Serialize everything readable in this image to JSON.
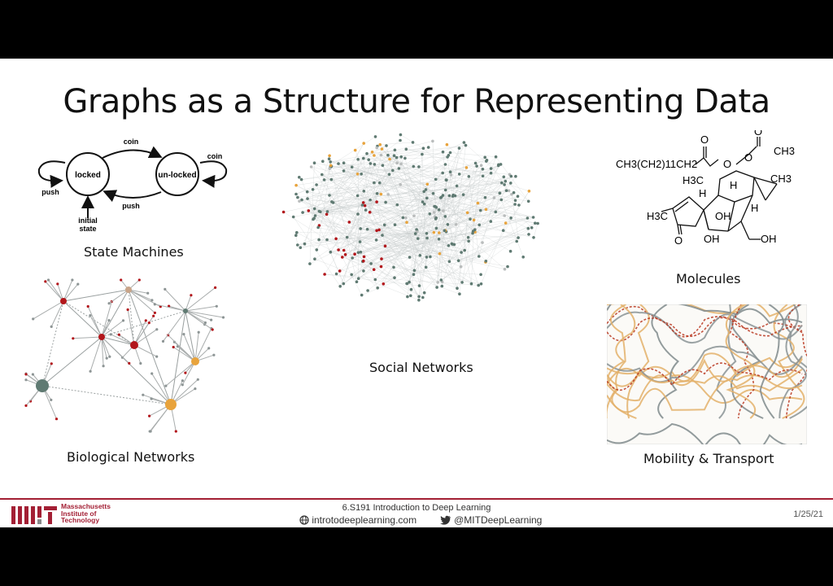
{
  "title": "Graphs as a Structure for Representing Data",
  "state_machine": {
    "caption": "State Machines",
    "node_locked": "locked",
    "node_unlocked": "un-locked",
    "edge_top": "coin",
    "edge_bottom": "push",
    "self_left": "push",
    "self_right": "coin",
    "initial_line1": "initial",
    "initial_line2": "state"
  },
  "social": {
    "caption": "Social Networks"
  },
  "molecule": {
    "caption": "Molecules",
    "chain": "CH3(CH2)11CH2",
    "ch3_top": "CH3",
    "ch3_right": "CH3",
    "ch3_left": "H3C",
    "ch3_far_left": "H3C",
    "h1": "H",
    "h2": "H",
    "h3": "H",
    "oh1": "OH",
    "oh2": "OH",
    "oh3": "OH",
    "o_ketone": "O",
    "o1": "O",
    "o2": "O",
    "o3": "O",
    "o4": "O"
  },
  "bio": {
    "caption": "Biological Networks"
  },
  "mobility": {
    "caption": "Mobility & Transport"
  },
  "footer": {
    "institute_line1": "Massachusetts",
    "institute_line2": "Institute of",
    "institute_line3": "Technology",
    "course": "6.S191 Introduction to Deep Learning",
    "website": "introtodeeplearning.com",
    "twitter": "@MITDeepLearning",
    "date": "1/25/21"
  },
  "colors": {
    "mit_red": "#a31f34",
    "node_gray": "#5f7a72",
    "node_red": "#b2161b",
    "node_orange": "#e8a33c"
  }
}
